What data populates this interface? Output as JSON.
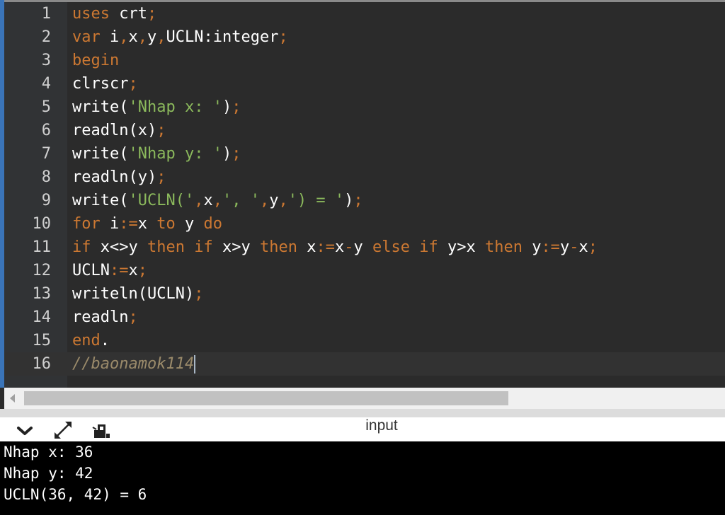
{
  "editor": {
    "lines": [
      {
        "number": "1",
        "code": "uses crt;"
      },
      {
        "number": "2",
        "code": "var i,x,y,UCLN:integer;"
      },
      {
        "number": "3",
        "code": "begin"
      },
      {
        "number": "4",
        "code": "clrscr;"
      },
      {
        "number": "5",
        "code": "write('Nhap x: ');"
      },
      {
        "number": "6",
        "code": "readln(x);"
      },
      {
        "number": "7",
        "code": "write('Nhap y: ');"
      },
      {
        "number": "8",
        "code": "readln(y);"
      },
      {
        "number": "9",
        "code": "write('UCLN(',x,', ',y,') = ');"
      },
      {
        "number": "10",
        "code": "for i:=x to y do"
      },
      {
        "number": "11",
        "code": "if x<>y then if x>y then x:=x-y else if y>x then y:=y-x;"
      },
      {
        "number": "12",
        "code": "UCLN:=x;"
      },
      {
        "number": "13",
        "code": "writeln(UCLN);"
      },
      {
        "number": "14",
        "code": "readln;"
      },
      {
        "number": "15",
        "code": "end."
      },
      {
        "number": "16",
        "code": "//baonamok114"
      }
    ],
    "current_line": 16
  },
  "panel": {
    "title": "input",
    "icons": [
      "chevron-down-icon",
      "expand-icon",
      "stop-icon"
    ]
  },
  "console": {
    "lines": [
      "Nhap x: 36",
      "Nhap y: 42",
      "UCLN(36, 42) = 6"
    ]
  },
  "colors": {
    "background": "#2b2b2b",
    "keyword": "#cc7832",
    "string": "#8bb95c",
    "comment": "#9a8a6a",
    "default_text": "#ffffff",
    "console_bg": "#000000"
  }
}
